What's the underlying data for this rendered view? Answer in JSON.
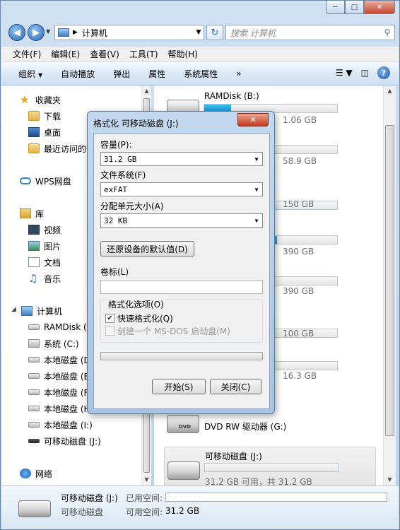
{
  "window": {
    "controls": {
      "minimize": "─",
      "maximize": "□",
      "close": "✕"
    }
  },
  "address": {
    "path_sep": "▶",
    "current": "计算机",
    "search_placeholder": "搜索 计算机"
  },
  "menubar": {
    "items": [
      "文件(F)",
      "编辑(E)",
      "查看(V)",
      "工具(T)",
      "帮助(H)"
    ]
  },
  "commandbar": {
    "organize": "组织",
    "autoplay": "自动播放",
    "eject": "弹出",
    "properties": "属性",
    "system_properties": "系统属性",
    "more": "»"
  },
  "navpane": {
    "favorites": "收藏夹",
    "downloads": "下载",
    "desktop": "桌面",
    "recent": "最近访问的位置",
    "wps": "WPS网盘",
    "libraries": "库",
    "videos": "视频",
    "pictures": "图片",
    "documents": "文档",
    "music": "音乐",
    "computer": "计算机",
    "drives": [
      "RAMDisk (B:)",
      "系统 (C:)",
      "本地磁盘 (D:)",
      "本地磁盘 (E:)",
      "本地磁盘 (F:)",
      "本地磁盘 (H:)",
      "本地磁盘 (I:)",
      "可移动磁盘 (J:)"
    ],
    "network": "网络"
  },
  "content": {
    "drives": [
      {
        "name": "RAMDisk (B:)",
        "info": "1.06 GB",
        "used_fraction": 0.2
      },
      {
        "name": "",
        "info": "58.9 GB",
        "used_fraction": 0.0
      },
      {
        "name": "",
        "info": "150 GB",
        "used_fraction": 0.0
      },
      {
        "name": "",
        "info": "390 GB",
        "used_fraction": 0.55
      },
      {
        "name": "",
        "info": "390 GB",
        "used_fraction": 0.0
      },
      {
        "name": "",
        "info": "100 GB",
        "used_fraction": 0.0
      },
      {
        "name": "",
        "info": "16.3 GB",
        "used_fraction": 0.0
      }
    ],
    "dvd": {
      "name": "DVD RW 驱动器 (G:)"
    },
    "removable": {
      "name": "可移动磁盘 (J:)",
      "info": "31.2 GB 可用，共 31.2 GB",
      "used_fraction": 0.0
    }
  },
  "details": {
    "title": "可移动磁盘 (J:)",
    "type": "可移动磁盘",
    "used_label": "已用空间:",
    "free_label": "可用空间:",
    "free_value": "31.2 GB"
  },
  "dialog": {
    "title": "格式化 可移动磁盘 (J:)",
    "close_glyph": "✕",
    "capacity_label": "容量(P):",
    "capacity_value": "31.2 GB",
    "filesystem_label": "文件系统(F)",
    "filesystem_value": "exFAT",
    "alloc_label": "分配单元大小(A)",
    "alloc_value": "32 KB",
    "restore_defaults": "还原设备的默认值(D)",
    "volume_label": "卷标(L)",
    "volume_value": "",
    "options_label": "格式化选项(O)",
    "quick_format": "快速格式化(Q)",
    "quick_format_checked": true,
    "msdos_boot": "创建一个 MS-DOS 启动盘(M)",
    "start": "开始(S)",
    "close": "关闭(C)"
  }
}
